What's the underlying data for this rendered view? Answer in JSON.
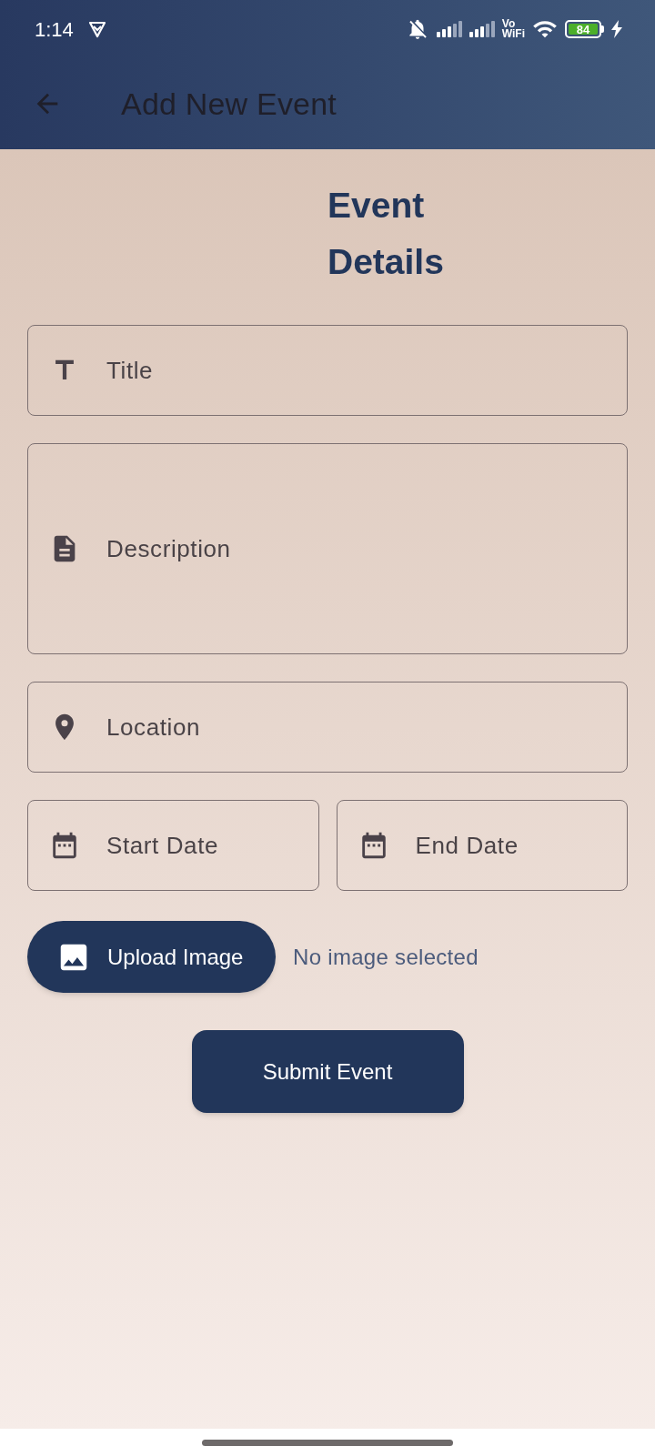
{
  "status_bar": {
    "time": "1:14",
    "vowifi": [
      "Vo",
      "WiFi"
    ],
    "battery": "84"
  },
  "app_bar": {
    "title": "Add New Event"
  },
  "form": {
    "heading": "Event Details",
    "fields": [
      {
        "kind": "title",
        "placeholder": "Title"
      },
      {
        "kind": "description",
        "placeholder": "Description"
      },
      {
        "kind": "location",
        "placeholder": "Location"
      }
    ],
    "date_fields": [
      {
        "placeholder": "Start Date"
      },
      {
        "placeholder": "End Date"
      }
    ],
    "upload": {
      "button": "Upload Image",
      "status": "No image selected"
    },
    "submit": "Submit Event"
  }
}
